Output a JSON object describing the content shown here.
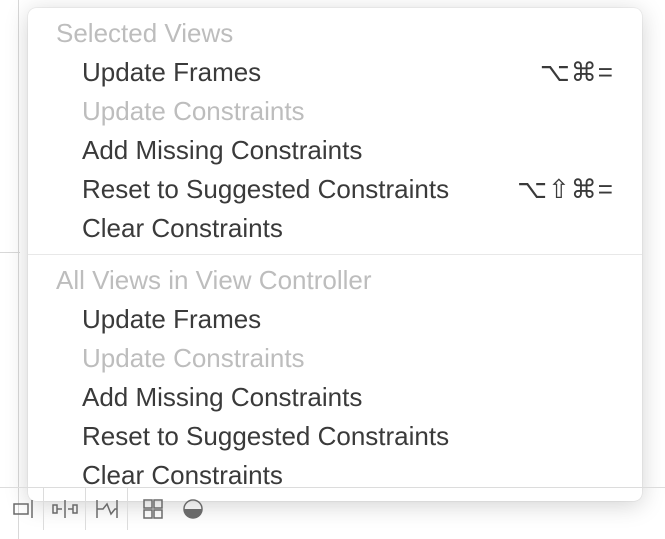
{
  "popover": {
    "sections": [
      {
        "header": "Selected Views",
        "items": [
          {
            "label": "Update Frames",
            "shortcut": "⌥⌘=",
            "disabled": false
          },
          {
            "label": "Update Constraints",
            "shortcut": "",
            "disabled": true
          },
          {
            "label": "Add Missing Constraints",
            "shortcut": "",
            "disabled": false
          },
          {
            "label": "Reset to Suggested Constraints",
            "shortcut": "⌥⇧⌘=",
            "disabled": false
          },
          {
            "label": "Clear Constraints",
            "shortcut": "",
            "disabled": false
          }
        ]
      },
      {
        "header": "All Views in View Controller",
        "items": [
          {
            "label": "Update Frames",
            "shortcut": "",
            "disabled": false
          },
          {
            "label": "Update Constraints",
            "shortcut": "",
            "disabled": true
          },
          {
            "label": "Add Missing Constraints",
            "shortcut": "",
            "disabled": false
          },
          {
            "label": "Reset to Suggested Constraints",
            "shortcut": "",
            "disabled": false
          },
          {
            "label": "Clear Constraints",
            "shortcut": "",
            "disabled": false
          }
        ]
      }
    ]
  },
  "toolbar": {
    "icons": [
      "align-right-icon",
      "align-horizontal-icon",
      "pin-icon",
      "stack-icon",
      "resolve-issues-icon"
    ]
  }
}
